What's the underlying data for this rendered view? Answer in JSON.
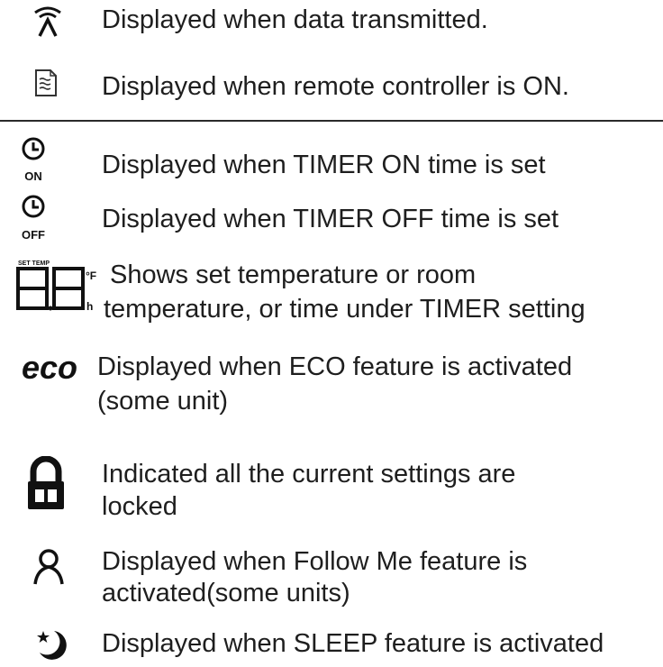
{
  "section_top": [
    {
      "icon": "signal-transmit-icon",
      "text": "Displayed when data transmitted."
    },
    {
      "icon": "remote-controller-icon",
      "text": "Displayed when remote controller is ON."
    }
  ],
  "section_bottom": [
    {
      "icon": "timer-on-icon",
      "icon_label": "ON",
      "text": "Displayed when TIMER ON time is set"
    },
    {
      "icon": "timer-off-icon",
      "icon_label": "OFF",
      "text": "Displayed when TIMER OFF time is set"
    },
    {
      "icon": "temperature-digits-icon",
      "icon_label_top": "SET TEMP",
      "icon_label_f": "°F",
      "icon_label_h": "h",
      "lines": [
        "Shows set temperature or room",
        "temperature, or time under TIMER setting"
      ]
    },
    {
      "icon": "eco-icon",
      "icon_label": "eco",
      "lines": [
        "Displayed when ECO feature is activated",
        "(some unit)"
      ]
    },
    {
      "icon": "lock-icon",
      "lines": [
        "Indicated all the current settings are",
        "locked"
      ]
    },
    {
      "icon": "follow-me-person-icon",
      "lines": [
        "Displayed when Follow Me feature is",
        "activated(some units)"
      ]
    },
    {
      "icon": "sleep-moon-icon",
      "text": "Displayed when SLEEP feature is activated"
    }
  ]
}
